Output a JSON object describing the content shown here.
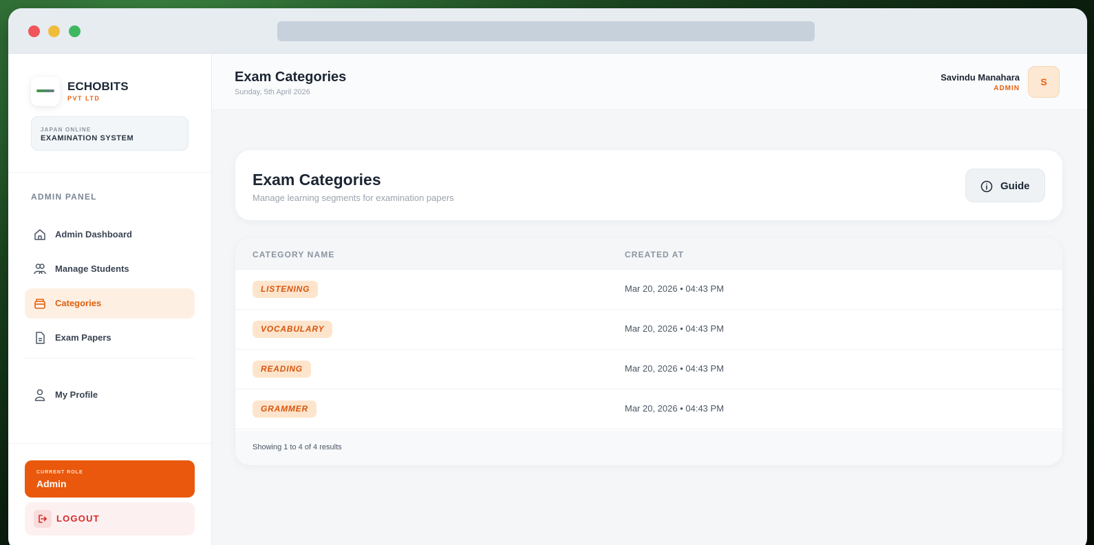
{
  "brand": {
    "name": "ECHOBITS",
    "sub": "PVT LTD",
    "system_line1": "JAPAN ONLINE",
    "system_line2": "EXAMINATION SYSTEM"
  },
  "sidebar": {
    "panel_label": "ADMIN PANEL",
    "items": [
      {
        "label": "Admin Dashboard",
        "icon": "home-icon",
        "active": false
      },
      {
        "label": "Manage Students",
        "icon": "users-icon",
        "active": false
      },
      {
        "label": "Categories",
        "icon": "folder-icon",
        "active": true
      },
      {
        "label": "Exam Papers",
        "icon": "document-icon",
        "active": false
      },
      {
        "label": "My Profile",
        "icon": "user-icon",
        "active": false
      }
    ],
    "role_label": "CURRENT ROLE",
    "role_value": "Admin",
    "logout_label": "LOGOUT"
  },
  "header": {
    "title": "Exam Categories",
    "date": "Sunday, 5th April 2026",
    "user_name": "Savindu Manahara",
    "user_role": "ADMIN",
    "avatar_initial": "S"
  },
  "hero": {
    "title": "Exam Categories",
    "subtitle": "Manage learning segments for examination papers",
    "guide_label": "Guide"
  },
  "table": {
    "columns": [
      "CATEGORY NAME",
      "CREATED AT"
    ],
    "rows": [
      {
        "name": "LISTENING",
        "created": "Mar 20, 2026 • 04:43 PM"
      },
      {
        "name": "VOCABULARY",
        "created": "Mar 20, 2026 • 04:43 PM"
      },
      {
        "name": "READING",
        "created": "Mar 20, 2026 • 04:43 PM"
      },
      {
        "name": "GRAMMER",
        "created": "Mar 20, 2026 • 04:43 PM"
      }
    ],
    "footer": "Showing 1 to 4 of 4 results"
  },
  "colors": {
    "accent": "#e9580c",
    "accent_soft": "#fde5cd",
    "danger": "#d62a2a"
  }
}
